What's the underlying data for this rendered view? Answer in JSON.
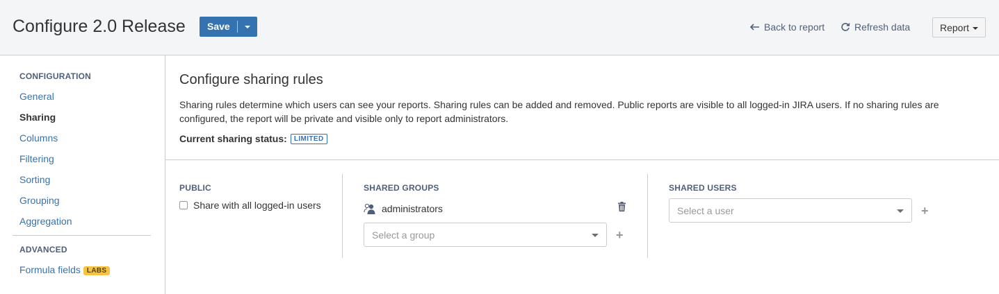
{
  "header": {
    "title": "Configure 2.0 Release",
    "save_label": "Save",
    "back_label": "Back to report",
    "refresh_label": "Refresh data",
    "report_label": "Report"
  },
  "sidebar": {
    "config_section": "CONFIGURATION",
    "items": [
      {
        "label": "General",
        "active": false
      },
      {
        "label": "Sharing",
        "active": true
      },
      {
        "label": "Columns",
        "active": false
      },
      {
        "label": "Filtering",
        "active": false
      },
      {
        "label": "Sorting",
        "active": false
      },
      {
        "label": "Grouping",
        "active": false
      },
      {
        "label": "Aggregation",
        "active": false
      }
    ],
    "advanced_section": "ADVANCED",
    "formula_label": "Formula fields",
    "labs_badge": "LABS"
  },
  "main": {
    "title": "Configure sharing rules",
    "description": "Sharing rules determine which users can see your reports. Sharing rules can be added and removed. Public reports are visible to all logged-in JIRA users. If no sharing rules are configured, the report will be private and visible only to report administrators.",
    "status_label": "Current sharing status:",
    "status_value": "LIMITED",
    "public": {
      "heading": "PUBLIC",
      "checkbox_label": "Share with all logged-in users",
      "checked": false
    },
    "groups": {
      "heading": "SHARED GROUPS",
      "items": [
        "administrators"
      ],
      "select_placeholder": "Select a group"
    },
    "users": {
      "heading": "SHARED USERS",
      "select_placeholder": "Select a user"
    }
  },
  "colors": {
    "primary": "#3572b0",
    "labs": "#f6c342",
    "header_bg": "#f4f5f7"
  }
}
